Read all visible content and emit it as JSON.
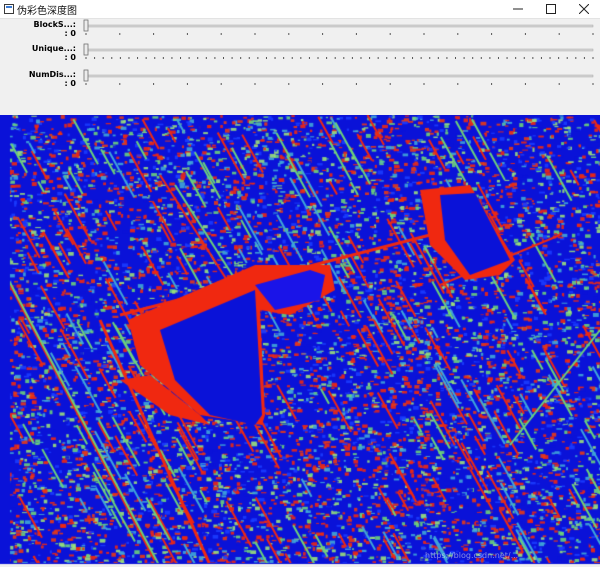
{
  "window": {
    "title": "伪彩色深度图",
    "icon": "app-window-icon",
    "controls": [
      "minimize-icon",
      "maximize-icon",
      "close-icon"
    ]
  },
  "trackbars": [
    {
      "name": "BlockS...:",
      "value": ": 0",
      "position": 0,
      "ticks": 16
    },
    {
      "name": "Unique...:",
      "value": ": 0",
      "position": 0,
      "ticks": 60
    },
    {
      "name": "NumDis...:",
      "value": ": 0",
      "position": 0,
      "ticks": 16
    }
  ],
  "image": {
    "kind": "pseudo-color disparity map",
    "colors": {
      "background": "#0a12d8",
      "red": "#f02810",
      "green": "#6cd17a",
      "cyan": "#3fa6d8"
    }
  },
  "watermark": "https://blog.csdn.net/..."
}
